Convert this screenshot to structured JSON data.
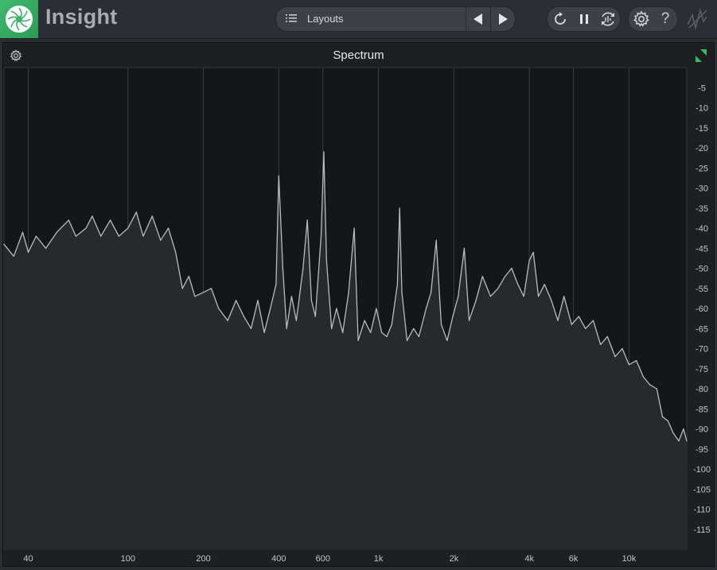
{
  "app": {
    "title": "Insight"
  },
  "toolbar": {
    "layouts_label": "Layouts",
    "icons": [
      "list-icon",
      "prev-arrow-icon",
      "next-arrow-icon",
      "reset-icon",
      "pause-icon",
      "sync-icon",
      "gear-icon",
      "help-icon",
      "signal-icon"
    ],
    "help_label": "?"
  },
  "panel": {
    "title": "Spectrum"
  },
  "colors": {
    "accent": "#3fbb6e",
    "trace": "#b9bcbf",
    "fill": "#27292d",
    "background": "#141619",
    "grid": "#3a3d42"
  },
  "chart_data": {
    "type": "area",
    "title": "Spectrum",
    "x_scale": "log",
    "xlim": [
      32,
      17000
    ],
    "ylim": [
      -120,
      0
    ],
    "x_ticks": [
      {
        "value": 40,
        "label": "40"
      },
      {
        "value": 100,
        "label": "100"
      },
      {
        "value": 200,
        "label": "200"
      },
      {
        "value": 400,
        "label": "400"
      },
      {
        "value": 600,
        "label": "600"
      },
      {
        "value": 1000,
        "label": "1k"
      },
      {
        "value": 2000,
        "label": "2k"
      },
      {
        "value": 4000,
        "label": "4k"
      },
      {
        "value": 6000,
        "label": "6k"
      },
      {
        "value": 10000,
        "label": "10k"
      }
    ],
    "y_ticks": [
      -5,
      -10,
      -15,
      -20,
      -25,
      -30,
      -35,
      -40,
      -45,
      -50,
      -55,
      -60,
      -65,
      -70,
      -75,
      -80,
      -85,
      -90,
      -95,
      -100,
      -105,
      -110,
      -115
    ],
    "grid": true,
    "series": [
      {
        "values": [
          [
            32,
            -44
          ],
          [
            35,
            -47
          ],
          [
            38,
            -41
          ],
          [
            40,
            -46
          ],
          [
            43,
            -42
          ],
          [
            47,
            -45
          ],
          [
            52,
            -41
          ],
          [
            58,
            -38
          ],
          [
            62,
            -42
          ],
          [
            68,
            -40
          ],
          [
            72,
            -37
          ],
          [
            78,
            -42
          ],
          [
            85,
            -38
          ],
          [
            92,
            -42
          ],
          [
            100,
            -40
          ],
          [
            108,
            -36
          ],
          [
            115,
            -42
          ],
          [
            125,
            -37
          ],
          [
            135,
            -43
          ],
          [
            145,
            -40
          ],
          [
            155,
            -46
          ],
          [
            165,
            -55
          ],
          [
            175,
            -52
          ],
          [
            185,
            -57
          ],
          [
            200,
            -56
          ],
          [
            215,
            -55
          ],
          [
            230,
            -60
          ],
          [
            250,
            -63
          ],
          [
            270,
            -58
          ],
          [
            290,
            -62
          ],
          [
            310,
            -65
          ],
          [
            330,
            -58
          ],
          [
            350,
            -66
          ],
          [
            370,
            -60
          ],
          [
            390,
            -54
          ],
          [
            400,
            -27
          ],
          [
            415,
            -50
          ],
          [
            430,
            -65
          ],
          [
            450,
            -57
          ],
          [
            470,
            -63
          ],
          [
            500,
            -50
          ],
          [
            520,
            -38
          ],
          [
            540,
            -58
          ],
          [
            560,
            -62
          ],
          [
            590,
            -42
          ],
          [
            605,
            -21
          ],
          [
            620,
            -48
          ],
          [
            650,
            -65
          ],
          [
            680,
            -60
          ],
          [
            720,
            -66
          ],
          [
            760,
            -56
          ],
          [
            800,
            -40
          ],
          [
            830,
            -68
          ],
          [
            880,
            -63
          ],
          [
            930,
            -66
          ],
          [
            980,
            -60
          ],
          [
            1030,
            -66
          ],
          [
            1080,
            -67
          ],
          [
            1130,
            -64
          ],
          [
            1190,
            -54
          ],
          [
            1215,
            -35
          ],
          [
            1240,
            -56
          ],
          [
            1300,
            -68
          ],
          [
            1380,
            -65
          ],
          [
            1450,
            -67
          ],
          [
            1550,
            -60
          ],
          [
            1620,
            -56
          ],
          [
            1700,
            -43
          ],
          [
            1780,
            -64
          ],
          [
            1880,
            -68
          ],
          [
            1980,
            -62
          ],
          [
            2080,
            -57
          ],
          [
            2200,
            -45
          ],
          [
            2300,
            -63
          ],
          [
            2450,
            -58
          ],
          [
            2600,
            -52
          ],
          [
            2800,
            -57
          ],
          [
            3000,
            -55
          ],
          [
            3200,
            -52
          ],
          [
            3400,
            -50
          ],
          [
            3600,
            -54
          ],
          [
            3800,
            -57
          ],
          [
            4000,
            -48
          ],
          [
            4150,
            -46
          ],
          [
            4350,
            -57
          ],
          [
            4600,
            -54
          ],
          [
            4900,
            -58
          ],
          [
            5200,
            -63
          ],
          [
            5500,
            -57
          ],
          [
            5900,
            -64
          ],
          [
            6300,
            -62
          ],
          [
            6700,
            -65
          ],
          [
            7200,
            -63
          ],
          [
            7700,
            -69
          ],
          [
            8200,
            -67
          ],
          [
            8800,
            -72
          ],
          [
            9400,
            -70
          ],
          [
            10000,
            -74
          ],
          [
            10700,
            -73
          ],
          [
            11400,
            -77
          ],
          [
            12100,
            -79
          ],
          [
            12900,
            -80
          ],
          [
            13600,
            -87
          ],
          [
            14300,
            -88
          ],
          [
            15000,
            -91
          ],
          [
            15800,
            -93
          ],
          [
            16500,
            -90
          ],
          [
            17000,
            -93
          ]
        ]
      }
    ]
  }
}
